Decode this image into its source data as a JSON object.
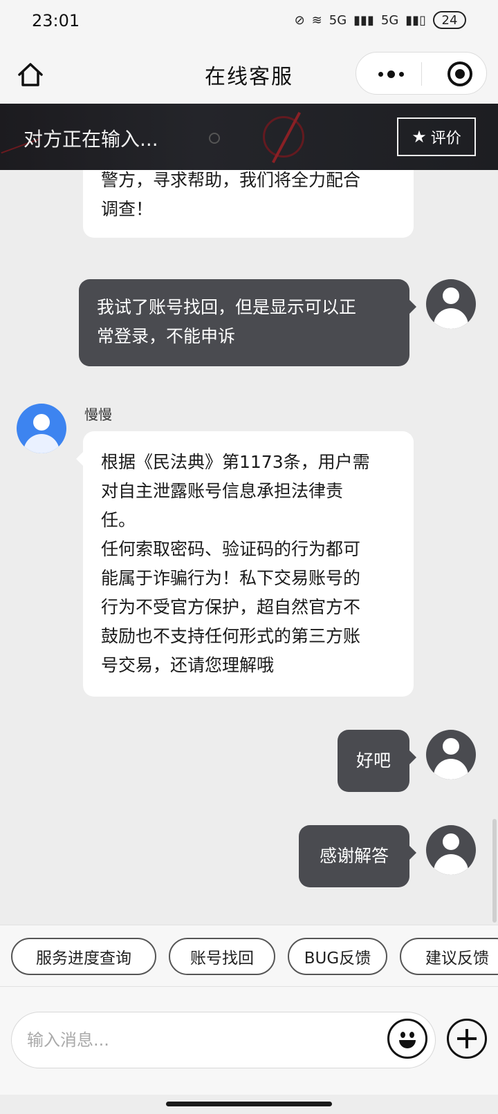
{
  "status_bar": {
    "time": "23:01",
    "network_1": "5G",
    "network_2": "5G",
    "battery": "24"
  },
  "nav": {
    "title": "在线客服"
  },
  "banner": {
    "typing": "对方正在输入...",
    "rate_label": "评价"
  },
  "messages": [
    {
      "sender": "agent",
      "text": "警方，寻求帮助，我们将全力配合\n调查！"
    },
    {
      "sender": "user",
      "text": "我试了账号找回，但是显示可以正\n常登录，不能申诉"
    },
    {
      "sender": "agent",
      "name": "慢慢",
      "text": "根据《民法典》第1173条，用户需\n对自主泄露账号信息承担法律责\n任。\n任何索取密码、验证码的行为都可\n能属于诈骗行为！私下交易账号的\n行为不受官方保护，超自然官方不\n鼓励也不支持任何形式的第三方账\n号交易，还请您理解哦"
    },
    {
      "sender": "user",
      "text": "好吧"
    },
    {
      "sender": "user",
      "text": "感谢解答"
    }
  ],
  "quick_replies": [
    "服务进度查询",
    "账号找回",
    "BUG反馈",
    "建议反馈"
  ],
  "input": {
    "placeholder": "输入消息..."
  },
  "colors": {
    "user_bubble": "#4a4b50",
    "agent_avatar": "#3d84f0",
    "banner_bg": "#1c1b1f"
  }
}
